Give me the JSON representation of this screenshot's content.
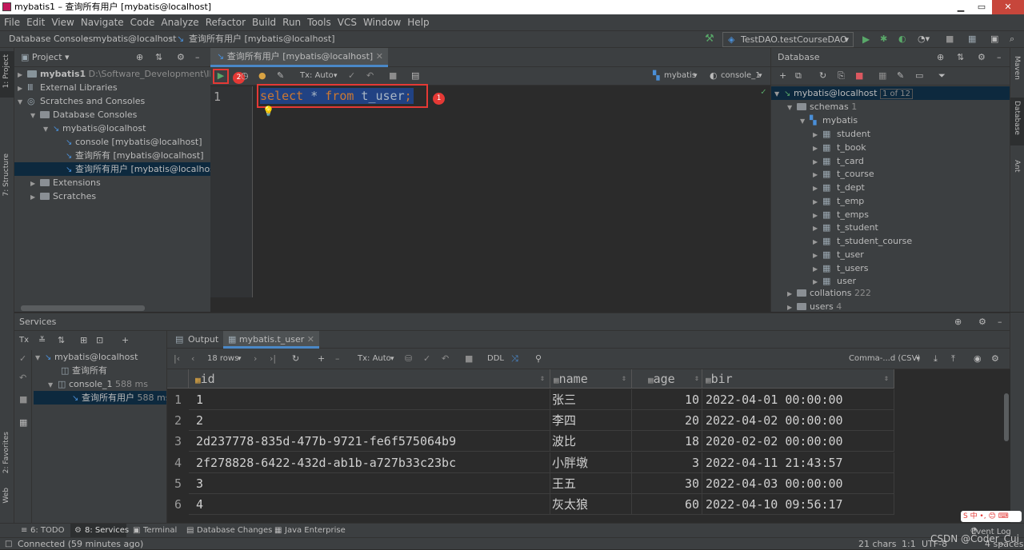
{
  "window": {
    "title": "mybatis1 – 查询所有用户 [mybatis@localhost]"
  },
  "menu": [
    "File",
    "Edit",
    "View",
    "Navigate",
    "Code",
    "Analyze",
    "Refactor",
    "Build",
    "Run",
    "Tools",
    "VCS",
    "Window",
    "Help"
  ],
  "breadcrumb": [
    "Database Consoles",
    "mybatis@localhost",
    "查询所有用户 [mybatis@localhost]"
  ],
  "run_config": "TestDAO.testCourseDAO",
  "project": {
    "header": "Project",
    "root_name": "mybatis1",
    "root_path": "D:\\Software_Development\\IDEA",
    "items": [
      "External Libraries",
      "Scratches and Consoles",
      "Database Consoles",
      "mybatis@localhost",
      "console [mybatis@localhost]",
      "查询所有 [mybatis@localhost]",
      "查询所有用户 [mybatis@localhost]",
      "Extensions",
      "Scratches"
    ]
  },
  "editor": {
    "tab": "查询所有用户 [mybatis@localhost]",
    "tx": "Tx: Auto",
    "datasource": "mybatis",
    "session": "console_1",
    "line_number": "1",
    "sql": {
      "kw1": "select",
      "star": " * ",
      "kw2": "from",
      "table": " t_user",
      "semi": ";"
    },
    "badge1": "1",
    "badge2": "2"
  },
  "database": {
    "header": "Database",
    "connection": "mybatis@localhost",
    "conn_count": "1 of 12",
    "schemas": "schemas",
    "schemas_count": "1",
    "schema": "mybatis",
    "tables": [
      "student",
      "t_book",
      "t_card",
      "t_course",
      "t_dept",
      "t_emp",
      "t_emps",
      "t_student",
      "t_student_course",
      "t_user",
      "t_users",
      "user"
    ],
    "collations": "collations",
    "collations_count": "222",
    "users": "users",
    "users_count": "4"
  },
  "services": {
    "header": "Services",
    "tree": {
      "conn": "mybatis@localhost",
      "query_all": "查询所有",
      "console": "console_1",
      "console_time": "588 ms",
      "query_users": "查询所有用户",
      "query_users_time": "588 ms"
    },
    "tabs": {
      "output": "Output",
      "result": "mybatis.t_user"
    },
    "toolbar": {
      "rows": "18 rows",
      "tx": "Tx: Auto",
      "ddl": "DDL",
      "export": "Comma-...d (CSV)"
    },
    "columns": [
      "id",
      "name",
      "age",
      "bir"
    ],
    "rows": [
      {
        "n": "1",
        "id": "1",
        "name": "张三",
        "age": "10",
        "bir": "2022-04-01 00:00:00"
      },
      {
        "n": "2",
        "id": "2",
        "name": "李四",
        "age": "20",
        "bir": "2022-04-02 00:00:00"
      },
      {
        "n": "3",
        "id": "2d237778-835d-477b-9721-fe6f575064b9",
        "name": "波比",
        "age": "18",
        "bir": "2020-02-02 00:00:00"
      },
      {
        "n": "4",
        "id": "2f278828-6422-432d-ab1b-a727b33c23bc",
        "name": "小胖墩",
        "age": "3",
        "bir": "2022-04-11 21:43:57"
      },
      {
        "n": "5",
        "id": "3",
        "name": "王五",
        "age": "30",
        "bir": "2022-04-03 00:00:00"
      },
      {
        "n": "6",
        "id": "4",
        "name": "灰太狼",
        "age": "60",
        "bir": "2022-04-10 09:56:17"
      }
    ]
  },
  "bottom_tabs": [
    "6: TODO",
    "8: Services",
    "Terminal",
    "Database Changes",
    "Java Enterprise"
  ],
  "event_log": "Event Log",
  "status": {
    "message": "Connected (59 minutes ago)",
    "chars": "21 chars",
    "pos": "1:1",
    "encoding": "UTF-8",
    "indent": "4 spaces"
  },
  "watermark": "CSDN @Coder_Cui",
  "left_stripe": [
    "1: Project",
    "7: Structure",
    "2: Favorites",
    "Web"
  ],
  "right_stripe": [
    "Maven",
    "Database",
    "Ant"
  ]
}
